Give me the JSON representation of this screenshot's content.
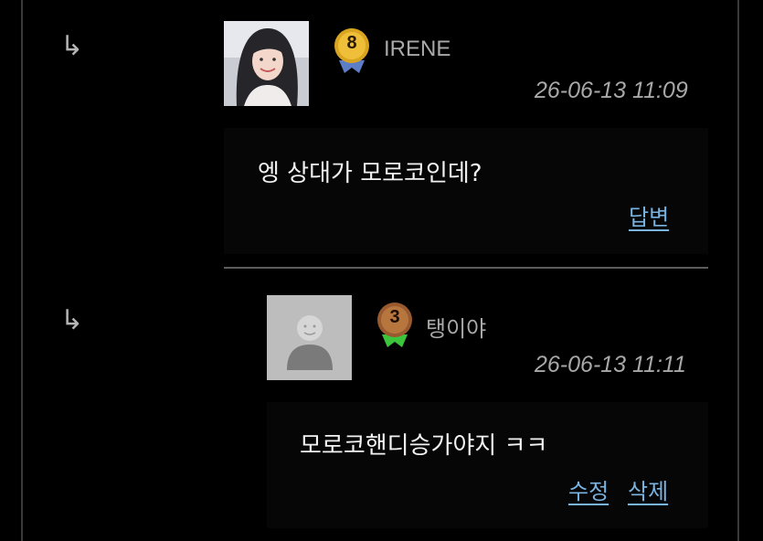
{
  "comments": [
    {
      "username": "IRENE",
      "level": "8",
      "timestamp": "26-06-13 11:09",
      "text": "엥 상대가 모로코인데?",
      "actions": {
        "reply": "답변"
      },
      "reply_icon": "reply-arrow-icon",
      "avatar": "profile-photo"
    },
    {
      "username": "탱이야",
      "level": "3",
      "timestamp": "26-06-13 11:11",
      "text": "모로코핸디승가야지 ㅋㅋ",
      "actions": {
        "edit": "수정",
        "delete": "삭제"
      },
      "reply_icon": "reply-arrow-icon",
      "avatar": "default-avatar"
    }
  ],
  "colors": {
    "background": "#000000",
    "link": "#7ab4e2",
    "badge_gold": "#d9a520",
    "badge_bronze": "#9a5a30",
    "ribbon_green": "#3cc43c"
  }
}
